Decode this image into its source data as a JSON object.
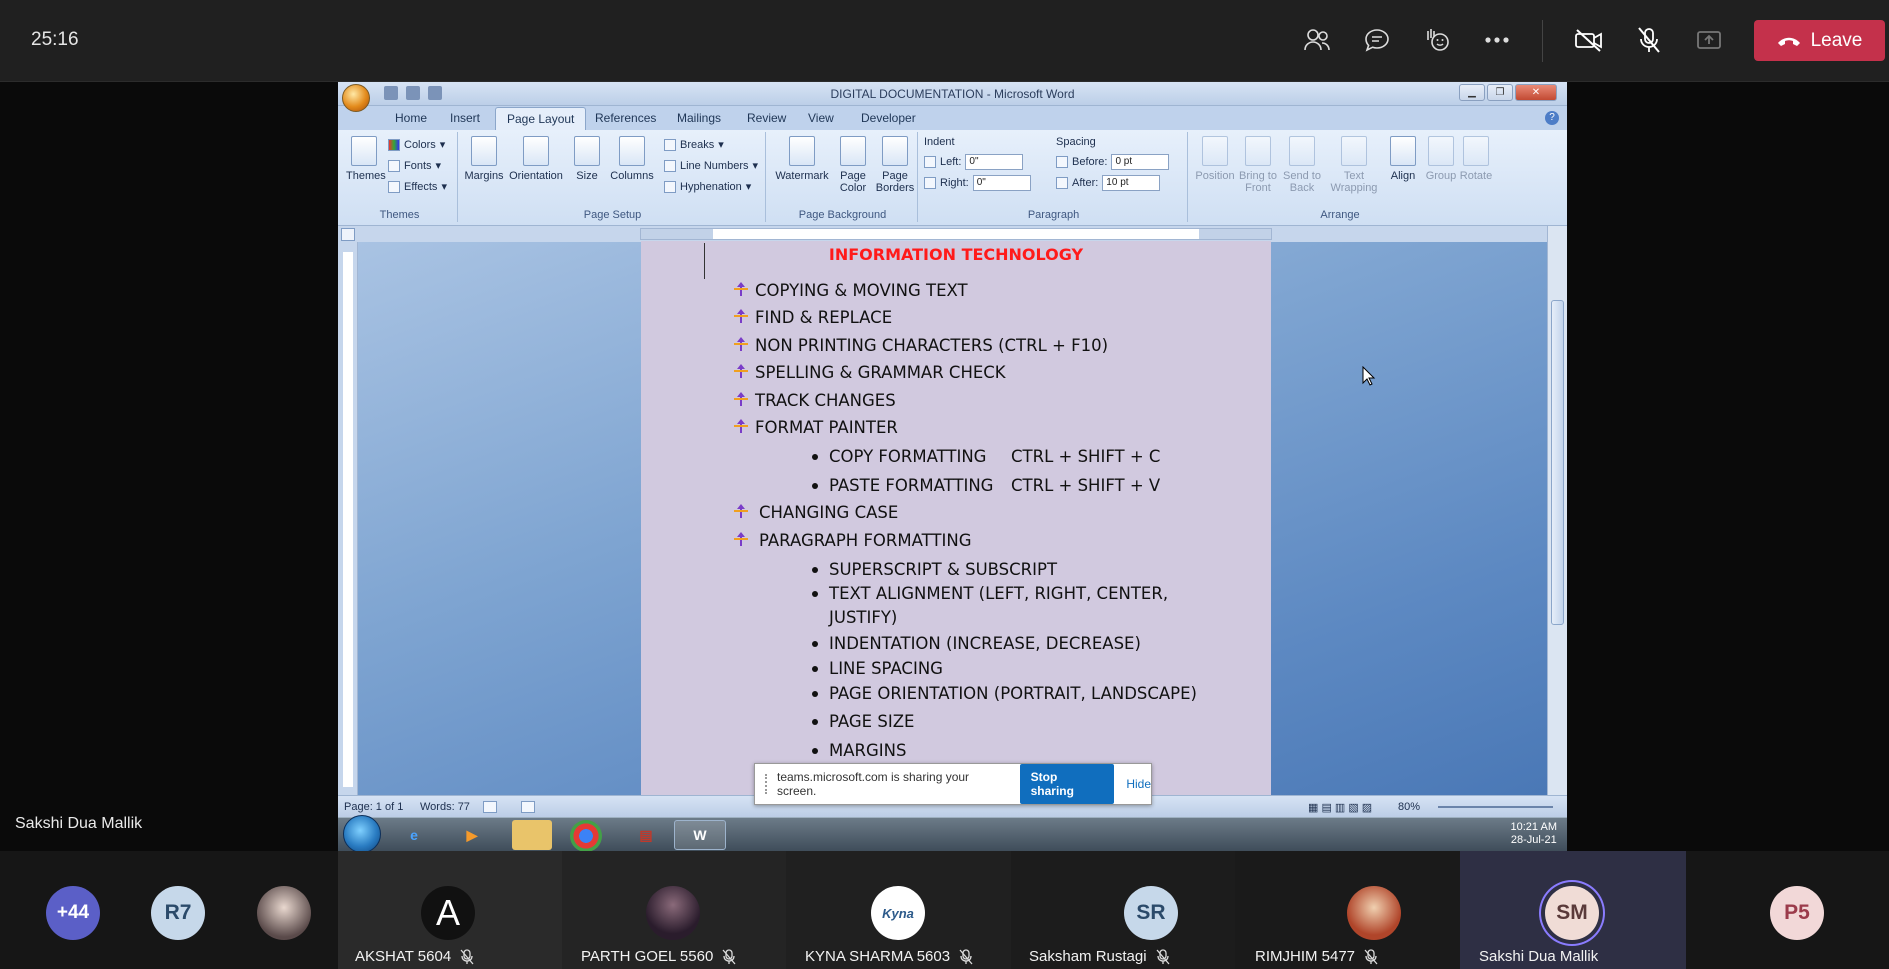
{
  "meeting": {
    "timer": "25:16",
    "leave_label": "Leave",
    "presenter_name": "Sakshi Dua Mallik"
  },
  "word": {
    "title": "DIGITAL DOCUMENTATION - Microsoft Word",
    "tabs": [
      "Home",
      "Insert",
      "Page Layout",
      "References",
      "Mailings",
      "Review",
      "View",
      "Developer"
    ],
    "active_tab": "Page Layout",
    "ribbon": {
      "themes": {
        "themes": "Themes",
        "colors": "Colors",
        "fonts": "Fonts",
        "effects": "Effects",
        "group": "Themes"
      },
      "page_setup": {
        "margins": "Margins",
        "orientation": "Orientation",
        "size": "Size",
        "columns": "Columns",
        "breaks": "Breaks",
        "line_numbers": "Line Numbers",
        "hyphenation": "Hyphenation",
        "group": "Page Setup"
      },
      "page_background": {
        "watermark": "Watermark",
        "page_color_1": "Page",
        "page_color_2": "Color",
        "page_borders_1": "Page",
        "page_borders_2": "Borders",
        "group": "Page Background"
      },
      "paragraph": {
        "indent": "Indent",
        "left_label": "Left:",
        "left_value": "0\"",
        "right_label": "Right:",
        "right_value": "0\"",
        "spacing": "Spacing",
        "before_label": "Before:",
        "before_value": "0 pt",
        "after_label": "After:",
        "after_value": "10 pt",
        "group": "Paragraph"
      },
      "arrange": {
        "position": "Position",
        "bring_front_1": "Bring to",
        "bring_front_2": "Front",
        "send_back_1": "Send to",
        "send_back_2": "Back",
        "text_wrap_1": "Text",
        "text_wrap_2": "Wrapping",
        "align": "Align",
        "group_btn": "Group",
        "rotate": "Rotate",
        "group": "Arrange"
      }
    },
    "document": {
      "title": "INFORMATION TECHNOLOGY",
      "items": [
        {
          "text": "COPYING & MOVING TEXT"
        },
        {
          "text": "FIND & REPLACE"
        },
        {
          "text": "NON PRINTING CHARACTERS (CTRL + F10)"
        },
        {
          "text": "SPELLING & GRAMMAR CHECK"
        },
        {
          "text": "TRACK CHANGES"
        },
        {
          "text": "FORMAT PAINTER"
        }
      ],
      "format_sub": [
        {
          "text": "COPY FORMATTING",
          "shortcut": "CTRL + SHIFT + C"
        },
        {
          "text": "PASTE FORMATTING",
          "shortcut": "CTRL + SHIFT + V"
        }
      ],
      "items2": [
        "CHANGING CASE",
        "PARAGRAPH FORMATTING"
      ],
      "para_sub": [
        "SUPERSCRIPT & SUBSCRIPT",
        "TEXT ALIGNMENT (LEFT, RIGHT, CENTER,",
        "JUSTIFY)",
        "INDENTATION (INCREASE, DECREASE)",
        "LINE SPACING",
        "PAGE ORIENTATION (PORTRAIT, LANDSCAPE)",
        "PAGE SIZE",
        "MARGINS"
      ]
    },
    "status": {
      "page": "Page: 1 of 1",
      "words": "Words: 77",
      "zoom": "80%"
    },
    "share_notice": {
      "text": "teams.microsoft.com is sharing your screen.",
      "stop": "Stop sharing",
      "hide": "Hide"
    },
    "taskbar": {
      "time": "10:21 AM",
      "date": "28-Jul-21"
    }
  },
  "participants": {
    "overflow": "+44",
    "r7": "R7",
    "tiles": [
      {
        "initials": "A",
        "name": "AKSHAT 5604"
      },
      {
        "initials": "",
        "name": "PARTH GOEL 5560"
      },
      {
        "initials": "Kyna",
        "name": "KYNA SHARMA 5603"
      },
      {
        "initials": "SR",
        "name": "Saksham Rustagi"
      },
      {
        "initials": "",
        "name": "RIMJHIM 5477"
      },
      {
        "initials": "SM",
        "name": "Sakshi Dua Mallik"
      }
    ],
    "p5": "P5"
  },
  "colors": {
    "leave": "#c4314b",
    "doc_title": "#ff1a1a",
    "stop_sharing": "#106ebe",
    "avatar_ring": "#8a7cff"
  }
}
